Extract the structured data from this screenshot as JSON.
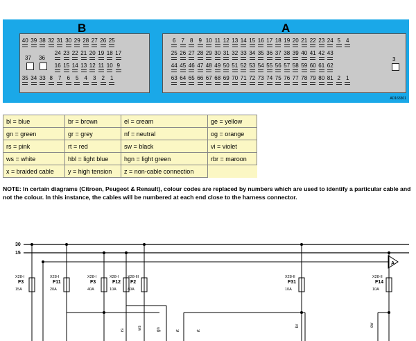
{
  "connectors": {
    "b": {
      "label": "B",
      "row1": [
        "40",
        "39",
        "38",
        "32",
        "31",
        "30",
        "29",
        "28",
        "27",
        "26",
        "25"
      ],
      "row2": [
        "24",
        "23",
        "22",
        "21",
        "20",
        "19",
        "18",
        "17"
      ],
      "row3": [
        "16",
        "15",
        "14",
        "13",
        "12",
        "11",
        "10",
        "9"
      ],
      "row4": [
        "35",
        "34",
        "33",
        "8",
        "7",
        "6",
        "5",
        "4",
        "3",
        "2",
        "1"
      ],
      "side": [
        "37",
        "36"
      ]
    },
    "a": {
      "label": "A",
      "row1": [
        "6",
        "7",
        "8",
        "9",
        "10",
        "11",
        "12",
        "13",
        "14",
        "15",
        "16",
        "17",
        "18",
        "19",
        "20",
        "21",
        "22",
        "23",
        "24",
        "5",
        "4"
      ],
      "row2": [
        "25",
        "26",
        "27",
        "28",
        "29",
        "30",
        "31",
        "32",
        "33",
        "34",
        "35",
        "36",
        "37",
        "38",
        "39",
        "40",
        "41",
        "42",
        "43"
      ],
      "row3": [
        "44",
        "45",
        "46",
        "47",
        "48",
        "49",
        "50",
        "51",
        "52",
        "53",
        "54",
        "55",
        "56",
        "57",
        "58",
        "59",
        "60",
        "61",
        "62"
      ],
      "row4": [
        "63",
        "64",
        "65",
        "66",
        "67",
        "68",
        "69",
        "70",
        "71",
        "72",
        "73",
        "74",
        "75",
        "76",
        "77",
        "78",
        "79",
        "80",
        "81",
        "2",
        "1"
      ],
      "side": [
        "3"
      ]
    },
    "part_code": "AD163301"
  },
  "legend": [
    [
      "bl = blue",
      "br = brown",
      "el = cream",
      "ge = yellow"
    ],
    [
      "gn = green",
      "gr = grey",
      "nf = neutral",
      "og = orange"
    ],
    [
      "rs = pink",
      "rt = red",
      "sw = black",
      "vi = violet"
    ],
    [
      "ws = white",
      "hbl = light blue",
      "hgn = light green",
      "rbr = maroon"
    ],
    [
      "x = braided cable",
      "y = high tension",
      "z = non-cable connection",
      ""
    ]
  ],
  "note": "NOTE: In certain diagrams (Citroen, Peugeot & Renault), colour codes are replaced by numbers which are used to identify a particular cable and not the colour. In this instance, the cables will be numbered at each end close to the harness connector.",
  "wiring": {
    "rails": [
      "30",
      "15"
    ],
    "fuses": [
      {
        "conn": "X28-I",
        "name": "F3",
        "rating": "15A"
      },
      {
        "conn": "X28-I",
        "name": "F11",
        "rating": "20A"
      },
      {
        "conn": "X28-I",
        "name": "F3",
        "rating": "40A"
      },
      {
        "conn": "X28-I",
        "name": "F12",
        "rating": "10A"
      },
      {
        "conn": "X28-III",
        "name": "F2",
        "rating": "80A"
      },
      {
        "conn": "X28-II",
        "name": "F31",
        "rating": "10A"
      },
      {
        "conn": "X28-II",
        "name": "F14",
        "rating": "10A"
      }
    ],
    "wire_labels": [
      "rs",
      "ws",
      "gn",
      "rt",
      "rt",
      "br",
      "sw"
    ],
    "arrow": "A"
  }
}
